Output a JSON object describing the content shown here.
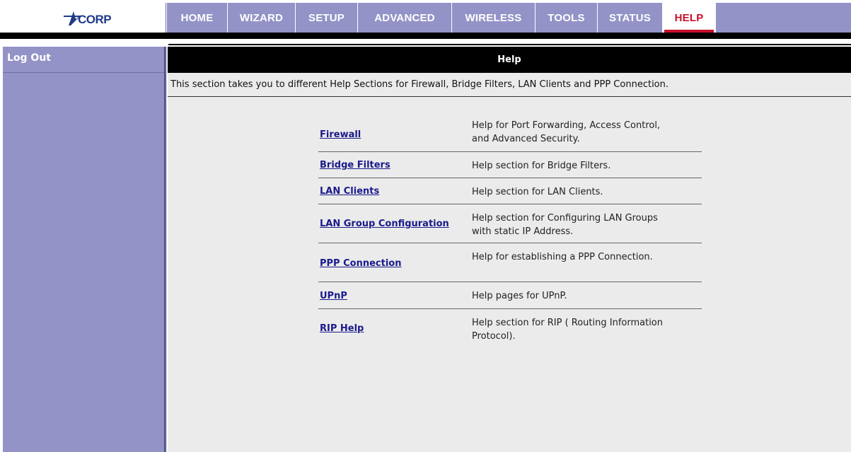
{
  "brand": {
    "logo_text": "ACORP"
  },
  "nav": {
    "tabs": [
      {
        "label": "HOME",
        "active": false
      },
      {
        "label": "WIZARD",
        "active": false
      },
      {
        "label": "SETUP",
        "active": false
      },
      {
        "label": "ADVANCED",
        "active": false
      },
      {
        "label": "WIRELESS",
        "active": false
      },
      {
        "label": "TOOLS",
        "active": false
      },
      {
        "label": "STATUS",
        "active": false
      },
      {
        "label": "HELP",
        "active": true
      }
    ]
  },
  "sidebar": {
    "logout_label": "Log Out"
  },
  "main": {
    "header": "Help",
    "intro": "This section takes you to different Help Sections for Firewall, Bridge Filters, LAN Clients and PPP Connection.",
    "items": [
      {
        "link": "Firewall",
        "description": "Help for Port Forwarding, Access Control, and Advanced Security."
      },
      {
        "link": "Bridge Filters",
        "description": "Help section for Bridge Filters."
      },
      {
        "link": "LAN Clients",
        "description": "Help section for LAN Clients."
      },
      {
        "link": "LAN Group Configuration",
        "description": "Help section for Configuring LAN Groups with static IP Address."
      },
      {
        "link": "PPP Connection",
        "description": "Help for establishing a PPP Connection."
      },
      {
        "link": "UPnP",
        "description": "Help pages for UPnP."
      },
      {
        "link": "RIP Help",
        "description": "Help section for RIP ( Routing Information Protocol)."
      }
    ]
  },
  "colors": {
    "nav_bg": "#9393c8",
    "active_tab_text": "#c8102e",
    "link": "#1a1a8c",
    "content_bg": "#ebebeb"
  }
}
